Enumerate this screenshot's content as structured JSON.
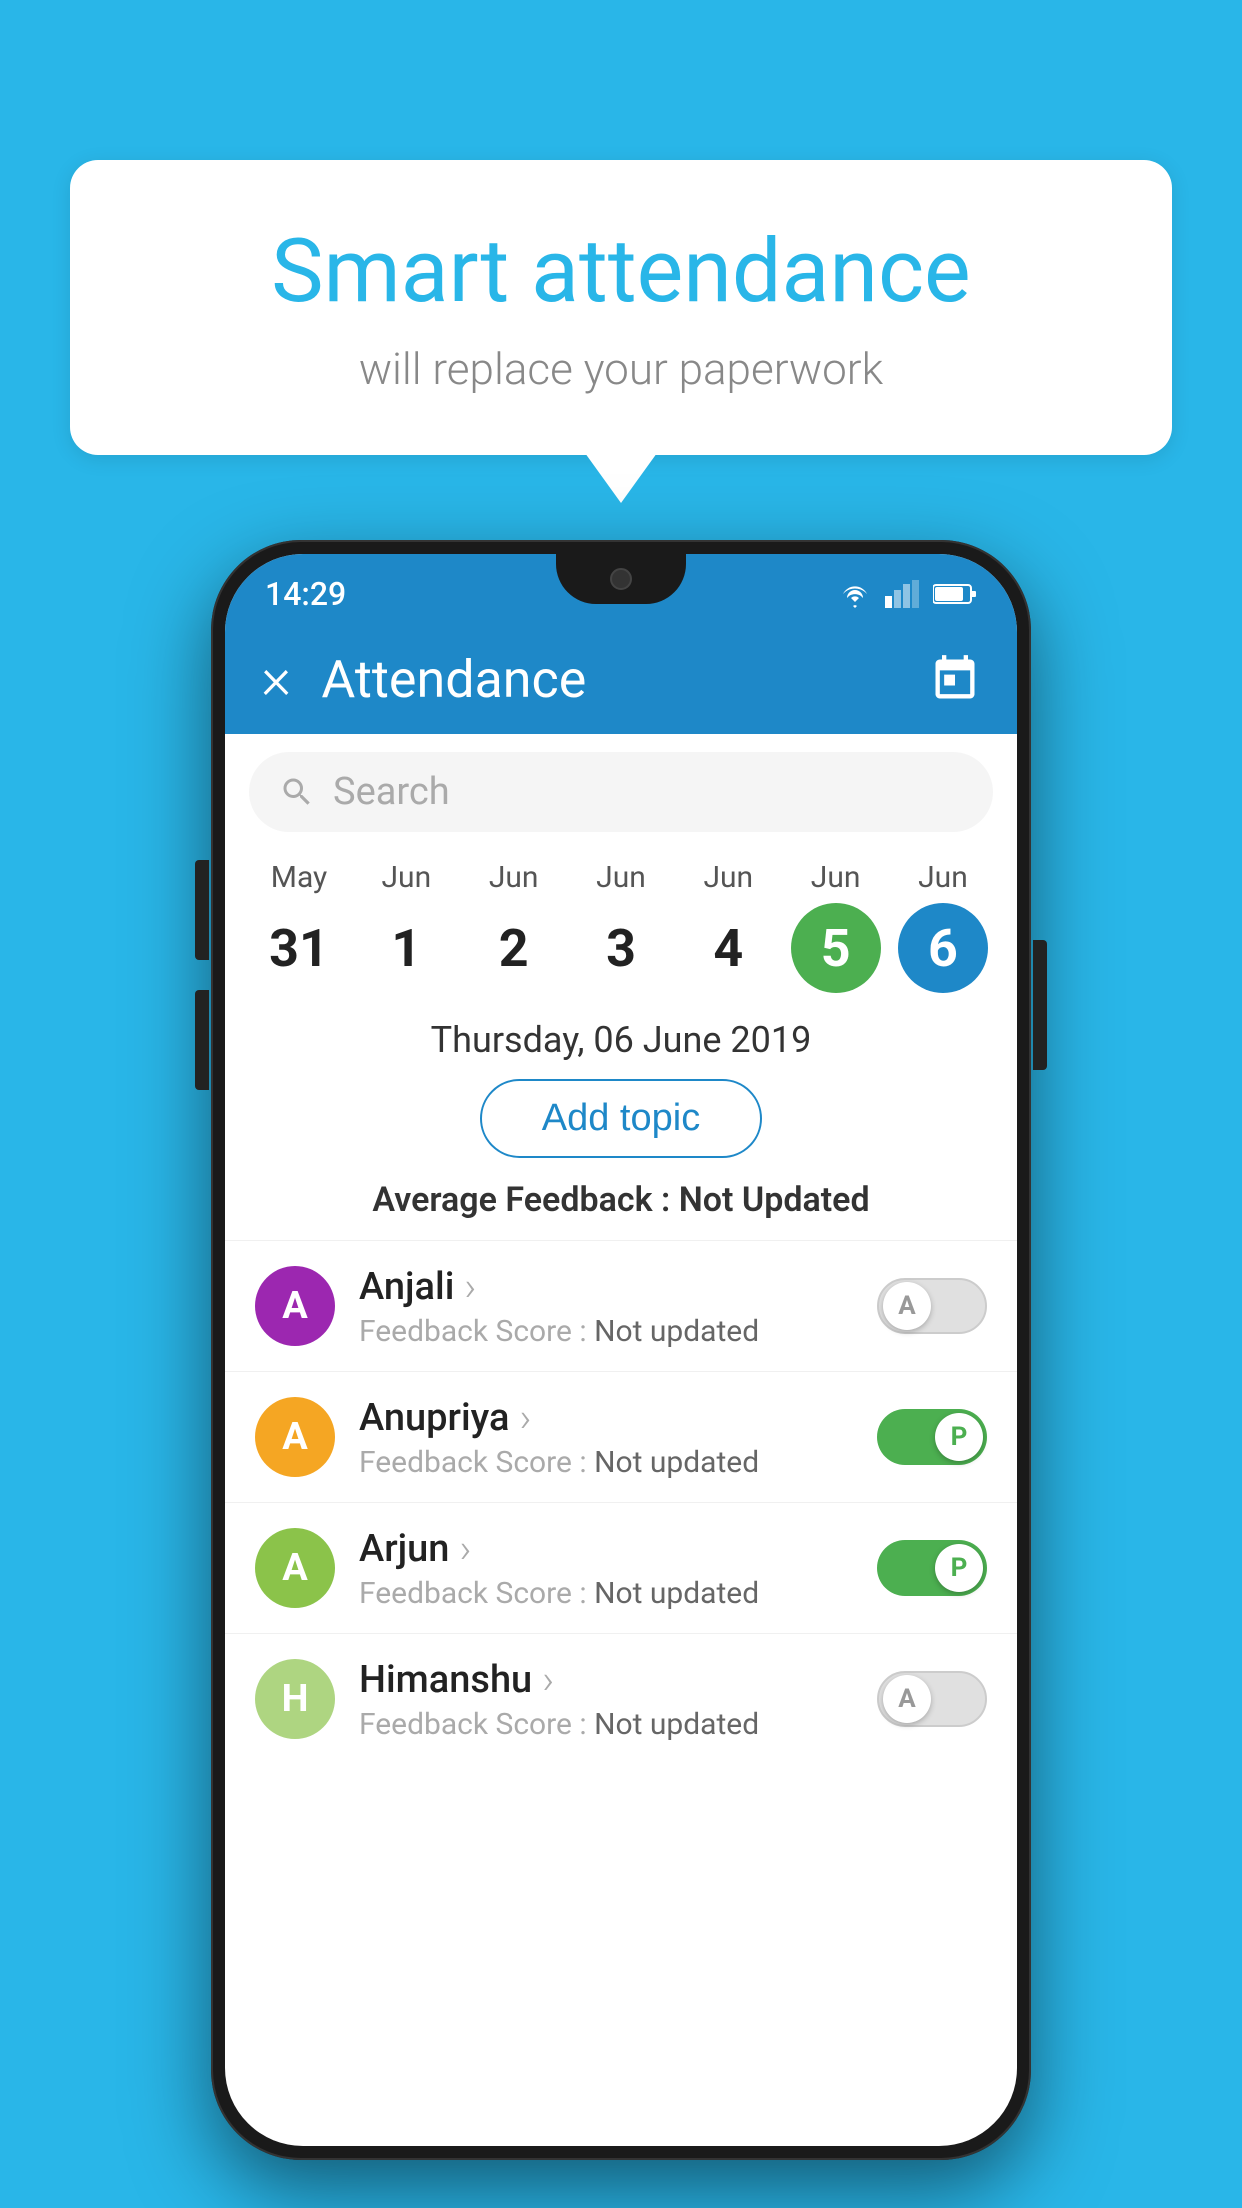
{
  "background_color": "#29b6e8",
  "speech_bubble": {
    "title": "Smart attendance",
    "subtitle": "will replace your paperwork"
  },
  "status_bar": {
    "time": "14:29",
    "wifi_icon": "wifi-icon",
    "signal_icon": "signal-icon",
    "battery_icon": "battery-icon"
  },
  "app_bar": {
    "title": "Attendance",
    "close_label": "×",
    "calendar_label": "calendar"
  },
  "search": {
    "placeholder": "Search"
  },
  "calendar": {
    "days": [
      {
        "month": "May",
        "date": "31",
        "style": "normal"
      },
      {
        "month": "Jun",
        "date": "1",
        "style": "normal"
      },
      {
        "month": "Jun",
        "date": "2",
        "style": "normal"
      },
      {
        "month": "Jun",
        "date": "3",
        "style": "normal"
      },
      {
        "month": "Jun",
        "date": "4",
        "style": "normal"
      },
      {
        "month": "Jun",
        "date": "5",
        "style": "today"
      },
      {
        "month": "Jun",
        "date": "6",
        "style": "selected"
      }
    ],
    "selected_date": "Thursday, 06 June 2019"
  },
  "add_topic_button": "Add topic",
  "avg_feedback": {
    "label": "Average Feedback : ",
    "value": "Not Updated"
  },
  "students": [
    {
      "name": "Anjali",
      "avatar_letter": "A",
      "avatar_color": "#9c27b0",
      "feedback_label": "Feedback Score : ",
      "feedback_value": "Not updated",
      "toggle": "off",
      "toggle_letter": "A"
    },
    {
      "name": "Anupriya",
      "avatar_letter": "A",
      "avatar_color": "#f5a623",
      "feedback_label": "Feedback Score : ",
      "feedback_value": "Not updated",
      "toggle": "on",
      "toggle_letter": "P"
    },
    {
      "name": "Arjun",
      "avatar_letter": "A",
      "avatar_color": "#8bc34a",
      "feedback_label": "Feedback Score : ",
      "feedback_value": "Not updated",
      "toggle": "on",
      "toggle_letter": "P"
    },
    {
      "name": "Himanshu",
      "avatar_letter": "H",
      "avatar_color": "#aed581",
      "feedback_label": "Feedback Score : ",
      "feedback_value": "Not updated",
      "toggle": "off",
      "toggle_letter": "A"
    }
  ]
}
